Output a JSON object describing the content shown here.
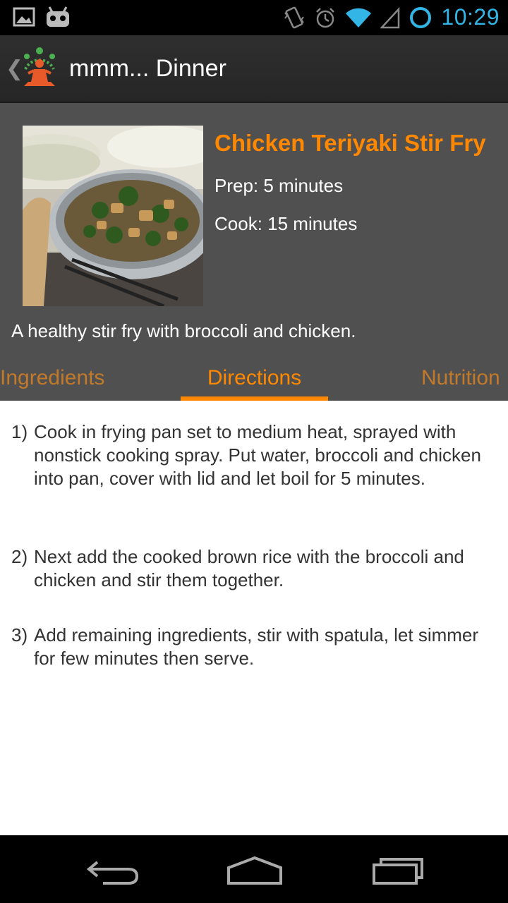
{
  "status_bar": {
    "time": "10:29",
    "icons": [
      "image-icon",
      "android-icon",
      "vibrate-icon",
      "alarm-icon",
      "wifi-icon",
      "signal-icon",
      "battery-icon"
    ],
    "accent_color": "#33b5e5"
  },
  "action_bar": {
    "title": "mmm... Dinner",
    "up_icon": "chevron-left-icon",
    "logo_icon": "app-logo-icon"
  },
  "recipe": {
    "title": "Chicken Teriyaki Stir Fry",
    "prep": "Prep: 5 minutes",
    "cook": "Cook: 15 minutes",
    "description": "A healthy stir fry with broccoli and chicken.",
    "accent_color": "#ff8800"
  },
  "tabs": [
    {
      "label": "Ingredients",
      "selected": false
    },
    {
      "label": "Directions",
      "selected": true
    },
    {
      "label": "Nutrition",
      "selected": false
    }
  ],
  "directions": [
    {
      "number": "1)",
      "text": "Cook in frying pan set to medium heat, sprayed with nonstick cooking spray. Put water, broccoli and chicken into pan, cover with lid and let boil for 5 minutes."
    },
    {
      "number": "2)",
      "text": "Next add the cooked brown rice with the broccoli and chicken and stir them together."
    },
    {
      "number": "3)",
      "text": "Add remaining ingredients, stir with spatula, let simmer for few minutes then serve."
    }
  ],
  "nav_bar": {
    "icons": [
      "back-icon",
      "home-icon",
      "recent-apps-icon"
    ]
  }
}
